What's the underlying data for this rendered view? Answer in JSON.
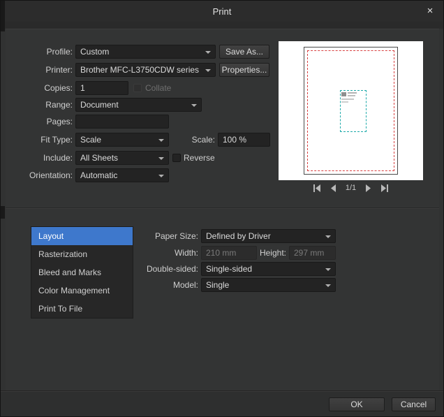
{
  "titlebar": {
    "title": "Print",
    "close_icon": "×"
  },
  "top_form": {
    "profile": {
      "label": "Profile:",
      "value": "Custom"
    },
    "save_as": {
      "label": "Save As..."
    },
    "printer": {
      "label": "Printer:",
      "value": "Brother MFC-L3750CDW series"
    },
    "properties": {
      "label": "Properties..."
    },
    "copies": {
      "label": "Copies:",
      "value": "1"
    },
    "collate": {
      "label": "Collate",
      "checked": false,
      "disabled": true
    },
    "range": {
      "label": "Range:",
      "value": "Document"
    },
    "pages": {
      "label": "Pages:",
      "value": ""
    },
    "fit_type": {
      "label": "Fit Type:",
      "value": "Scale"
    },
    "scale": {
      "label": "Scale:",
      "value": "100 %"
    },
    "include": {
      "label": "Include:",
      "value": "All Sheets"
    },
    "reverse": {
      "label": "Reverse",
      "checked": false
    },
    "orientation": {
      "label": "Orientation:",
      "value": "Automatic"
    }
  },
  "preview": {
    "page_indicator": "1/1"
  },
  "sections": {
    "items": [
      {
        "label": "Layout",
        "selected": true
      },
      {
        "label": "Rasterization",
        "selected": false
      },
      {
        "label": "Bleed and Marks",
        "selected": false
      },
      {
        "label": "Color Management",
        "selected": false
      },
      {
        "label": "Print To File",
        "selected": false
      }
    ]
  },
  "layout_form": {
    "paper_size": {
      "label": "Paper Size:",
      "value": "Defined by Driver"
    },
    "width": {
      "label": "Width:",
      "value": "210 mm",
      "disabled": true
    },
    "height": {
      "label": "Height:",
      "value": "297 mm",
      "disabled": true
    },
    "double_sided": {
      "label": "Double-sided:",
      "value": "Single-sided"
    },
    "model": {
      "label": "Model:",
      "value": "Single"
    }
  },
  "footer": {
    "ok": "OK",
    "cancel": "Cancel"
  },
  "colors": {
    "selection_blue": "#3e78cc",
    "preview_margin_red": "#d84040",
    "preview_selection_teal": "#1ca9a9"
  }
}
